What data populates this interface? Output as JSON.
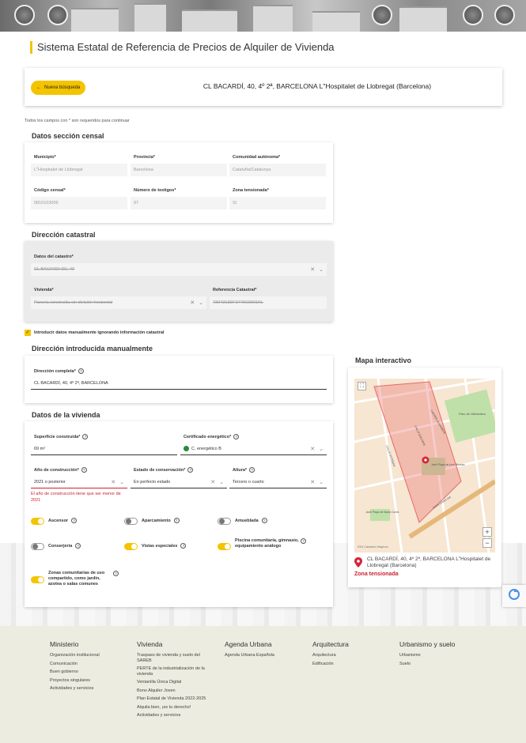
{
  "page": {
    "title": "Sistema Estatal de Referencia de Precios de Alquiler de Vivienda",
    "new_search_label": "Nueva búsqueda",
    "address": "CL BACARDÍ, 40, 4º 2ª, BARCELONA L\"Hospitalet de Llobregat (Barcelona)",
    "required_note": "Todos los campos con * son requeridos para continuar"
  },
  "censal": {
    "title": "Datos sección censal",
    "fields": [
      {
        "label": "Municipio*",
        "value": "L\"Hospitalet de Llobregat"
      },
      {
        "label": "Provincia*",
        "value": "Barcelona"
      },
      {
        "label": "Comunidad autónoma*",
        "value": "Cataluña/Catalunya"
      },
      {
        "label": "Código censal*",
        "value": "0810103009"
      },
      {
        "label": "Número de testigos*",
        "value": "97"
      },
      {
        "label": "Zona tensionada*",
        "value": "Sí"
      }
    ]
  },
  "catastral": {
    "title": "Dirección catastral",
    "datos_label": "Datos del catastro*",
    "datos_value": "CL BACARDI DE, 40",
    "vivienda_label": "Vivienda*",
    "vivienda_value": "Parcela construida sin división horizontal",
    "ref_label": "Referencia Catastral*",
    "ref_value": "7394213DF2779C0001KL"
  },
  "manual": {
    "checkbox_label": "Introducir datos manualmente ignorando información catastral",
    "title": "Dirección introducida manualmente",
    "direccion_label": "Dirección completa*",
    "direccion_value": "CL BACARDÍ, 40, 4º 2ª, BARCELONA"
  },
  "vivienda": {
    "title": "Datos de la vivienda",
    "superficie_label": "Superficie construida*",
    "superficie_value": "69  m²",
    "certificado_label": "Certificado energético*",
    "certificado_value": "C. energético B",
    "anio_label": "Año de construcción*",
    "anio_value": "2021 o posterior",
    "anio_error": "El año de construcción tiene que ser menor de 2021",
    "estado_label": "Estado de conservación*",
    "estado_value": "En perfecto estado",
    "altura_label": "Altura*",
    "altura_value": "Tercero o cuarto",
    "toggles": [
      {
        "label": "Ascensor",
        "on": true
      },
      {
        "label": "Aparcamiento",
        "on": false
      },
      {
        "label": "Amueblada",
        "on": false
      },
      {
        "label": "Conserjería",
        "on": false
      },
      {
        "label": "Vistas especiales",
        "on": true
      },
      {
        "label": "Piscina comunitaria, gimnasio, equipamiento análogo",
        "on": true
      },
      {
        "label": "Zonas comunitarias de uso compartido, como jardín, azotea o salas comunes",
        "on": true
      }
    ]
  },
  "map": {
    "title": "Mapa interactivo",
    "address": "CL BACARDÍ, 40, 4º 2ª, BARCELONA L\"Hospitalet de Llobregat (Barcelona)",
    "zone": "Zona tensionada",
    "attribution": "IGN Catastro Mapbox",
    "streets": [
      "Parc de l'Alhambra",
      "CALLE BACARDI",
      "CARRER ALHAMBRA",
      "Jardí Plaça de josé Bricesa",
      "CALLE ESTEBAN",
      "AVDA GRAN VIA"
    ],
    "poi": "Jardí Plaça de Maria Cores",
    "zoom_in": "+",
    "zoom_out": "−"
  },
  "footer": {
    "columns": [
      {
        "title": "Ministerio",
        "items": [
          "Organización institucional",
          "Comunicación",
          "Buen gobierno",
          "Proyectos singulares",
          "Actividades y servicios"
        ]
      },
      {
        "title": "Vivienda",
        "items": [
          "Traspaso de vivienda y suelo del SAREB",
          "PERTE de la industrialización de la vivienda",
          "Ventanilla Única Digital",
          "Bono Alquiler Joven",
          "Plan Estatal de Vivienda 2022-2025",
          "Alquila bien, ¡es tu derecho!",
          "Actividades y servicios"
        ]
      },
      {
        "title": "Agenda Urbana",
        "items": [
          "Agenda Urbana Española"
        ]
      },
      {
        "title": "Arquitectura",
        "items": [
          "Arquitectura",
          "Edificación"
        ]
      },
      {
        "title": "Urbanismo y suelo",
        "items": [
          "Urbanismo",
          "Suelo"
        ]
      }
    ]
  },
  "colors": {
    "accent": "#f4c400",
    "error": "#cc2233",
    "map_zone": "#e86a6a"
  }
}
